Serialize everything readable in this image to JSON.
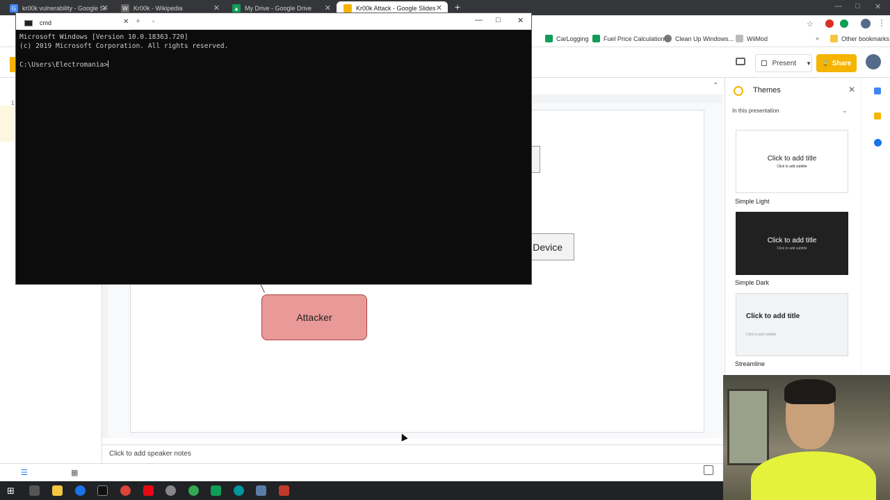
{
  "browser": {
    "tabs": [
      {
        "label": "kr00k vulnerability - Google Sea",
        "icon": "google-icon",
        "color": "#4285f4"
      },
      {
        "label": "Kr00k - Wikipedia",
        "icon": "wikipedia-icon",
        "color": "#666666"
      },
      {
        "label": "My Drive - Google Drive",
        "icon": "drive-icon",
        "color": "#0f9d58"
      },
      {
        "label": "Kr00k Attack - Google Slides",
        "icon": "slides-icon",
        "color": "#f4b400",
        "active": true
      }
    ],
    "bookmarks": [
      {
        "label": "CarLogging",
        "color": "#0f9d58"
      },
      {
        "label": "Fuel Price Calculation",
        "color": "#0f9d58"
      },
      {
        "label": "Clean Up Windows...",
        "color": "#777777"
      },
      {
        "label": "WiiMod",
        "color": "#999999"
      }
    ],
    "other_bookmarks": "Other bookmarks"
  },
  "slides": {
    "present_label": "Present",
    "share_label": "Share",
    "speaker_notes": "Click to add speaker notes",
    "diagram": {
      "attacker_label": "Attacker",
      "device_label": "Device"
    },
    "filmstrip_number": "1"
  },
  "themes": {
    "title": "Themes",
    "section": "In this presentation",
    "items": [
      {
        "name": "Simple Light",
        "title": "Click to add title",
        "subtitle": "Click to add subtitle"
      },
      {
        "name": "Simple Dark",
        "title": "Click to add title",
        "subtitle": "Click to add subtitle"
      },
      {
        "name": "Streamline",
        "title": "Click to add title",
        "subtitle": "Click to add subtitle"
      }
    ]
  },
  "cmd": {
    "tab_label": "cmd",
    "line1": "Microsoft Windows [Version 10.0.18363.720]",
    "line2": "(c) 2019 Microsoft Corporation. All rights reserved.",
    "prompt": "C:\\Users\\Electromania>"
  }
}
